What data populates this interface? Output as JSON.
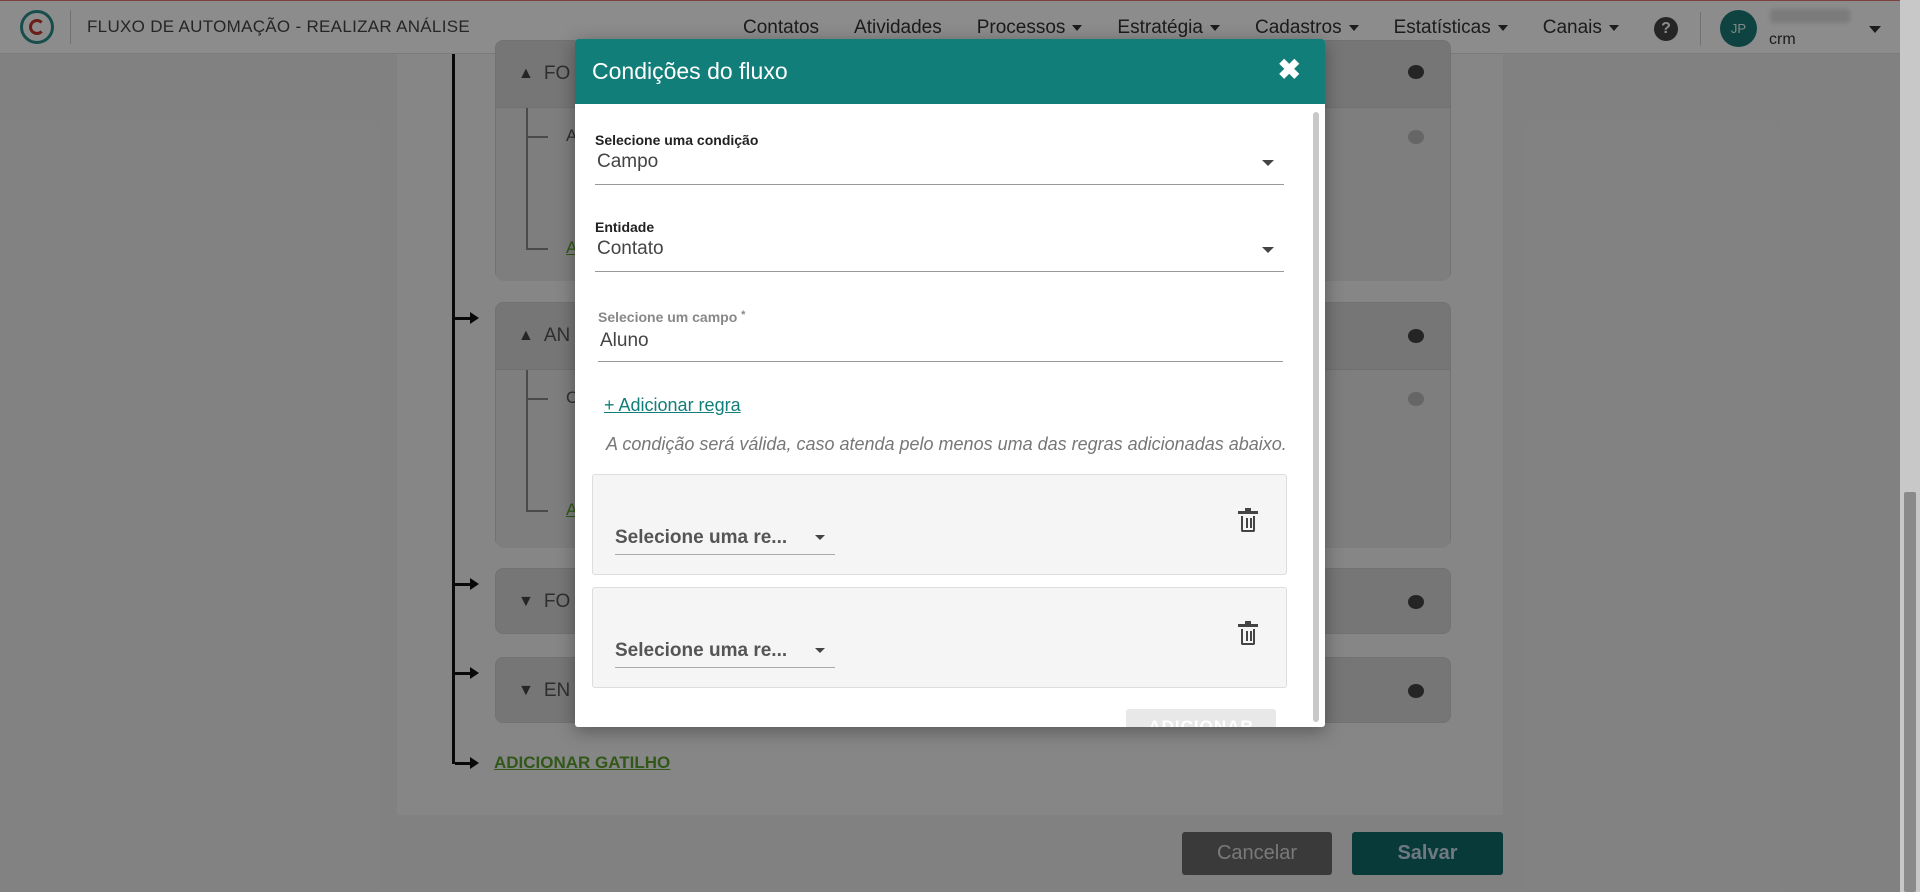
{
  "header": {
    "app_title": "FLUXO DE AUTOMAÇÃO - REALIZAR ANÁLISE",
    "menu": [
      {
        "label": "Contatos",
        "dropdown": false
      },
      {
        "label": "Atividades",
        "dropdown": false
      },
      {
        "label": "Processos",
        "dropdown": true
      },
      {
        "label": "Estratégia",
        "dropdown": true
      },
      {
        "label": "Cadastros",
        "dropdown": true
      },
      {
        "label": "Estatísticas",
        "dropdown": true
      },
      {
        "label": "Canais",
        "dropdown": true
      }
    ],
    "help_icon": "question-circle-icon",
    "user": {
      "initials": "JP",
      "org": "crm"
    }
  },
  "background": {
    "cards": [
      {
        "title": "FO",
        "expanded": true,
        "sub_text": "A",
        "sub_link": "A"
      },
      {
        "title": "AN",
        "expanded": true,
        "sub_text": "C",
        "sub_link": "A"
      },
      {
        "title": "FO",
        "expanded": false
      },
      {
        "title": "EN",
        "expanded": false
      }
    ],
    "add_trigger_label": "ADICIONAR GATILHO",
    "cancel_label": "Cancelar",
    "save_label": "Salvar"
  },
  "modal": {
    "title": "Condições do fluxo",
    "close_icon": "close-icon",
    "condition": {
      "label": "Selecione uma condição",
      "value": "Campo"
    },
    "entity": {
      "label": "Entidade",
      "value": "Contato"
    },
    "field": {
      "label": "Selecione um campo",
      "required_mark": "*",
      "value": "Aluno"
    },
    "add_rule_label": "+ Adicionar regra",
    "hint": "A condição será válida, caso atenda pelo menos uma das regras adicionadas abaixo.",
    "rules": [
      {
        "select_placeholder": "Selecione uma re..."
      },
      {
        "select_placeholder": "Selecione uma re..."
      }
    ],
    "add_button_label": "ADICIONAR"
  },
  "colors": {
    "brand": "#127e79",
    "link_green": "#5aa02c"
  }
}
